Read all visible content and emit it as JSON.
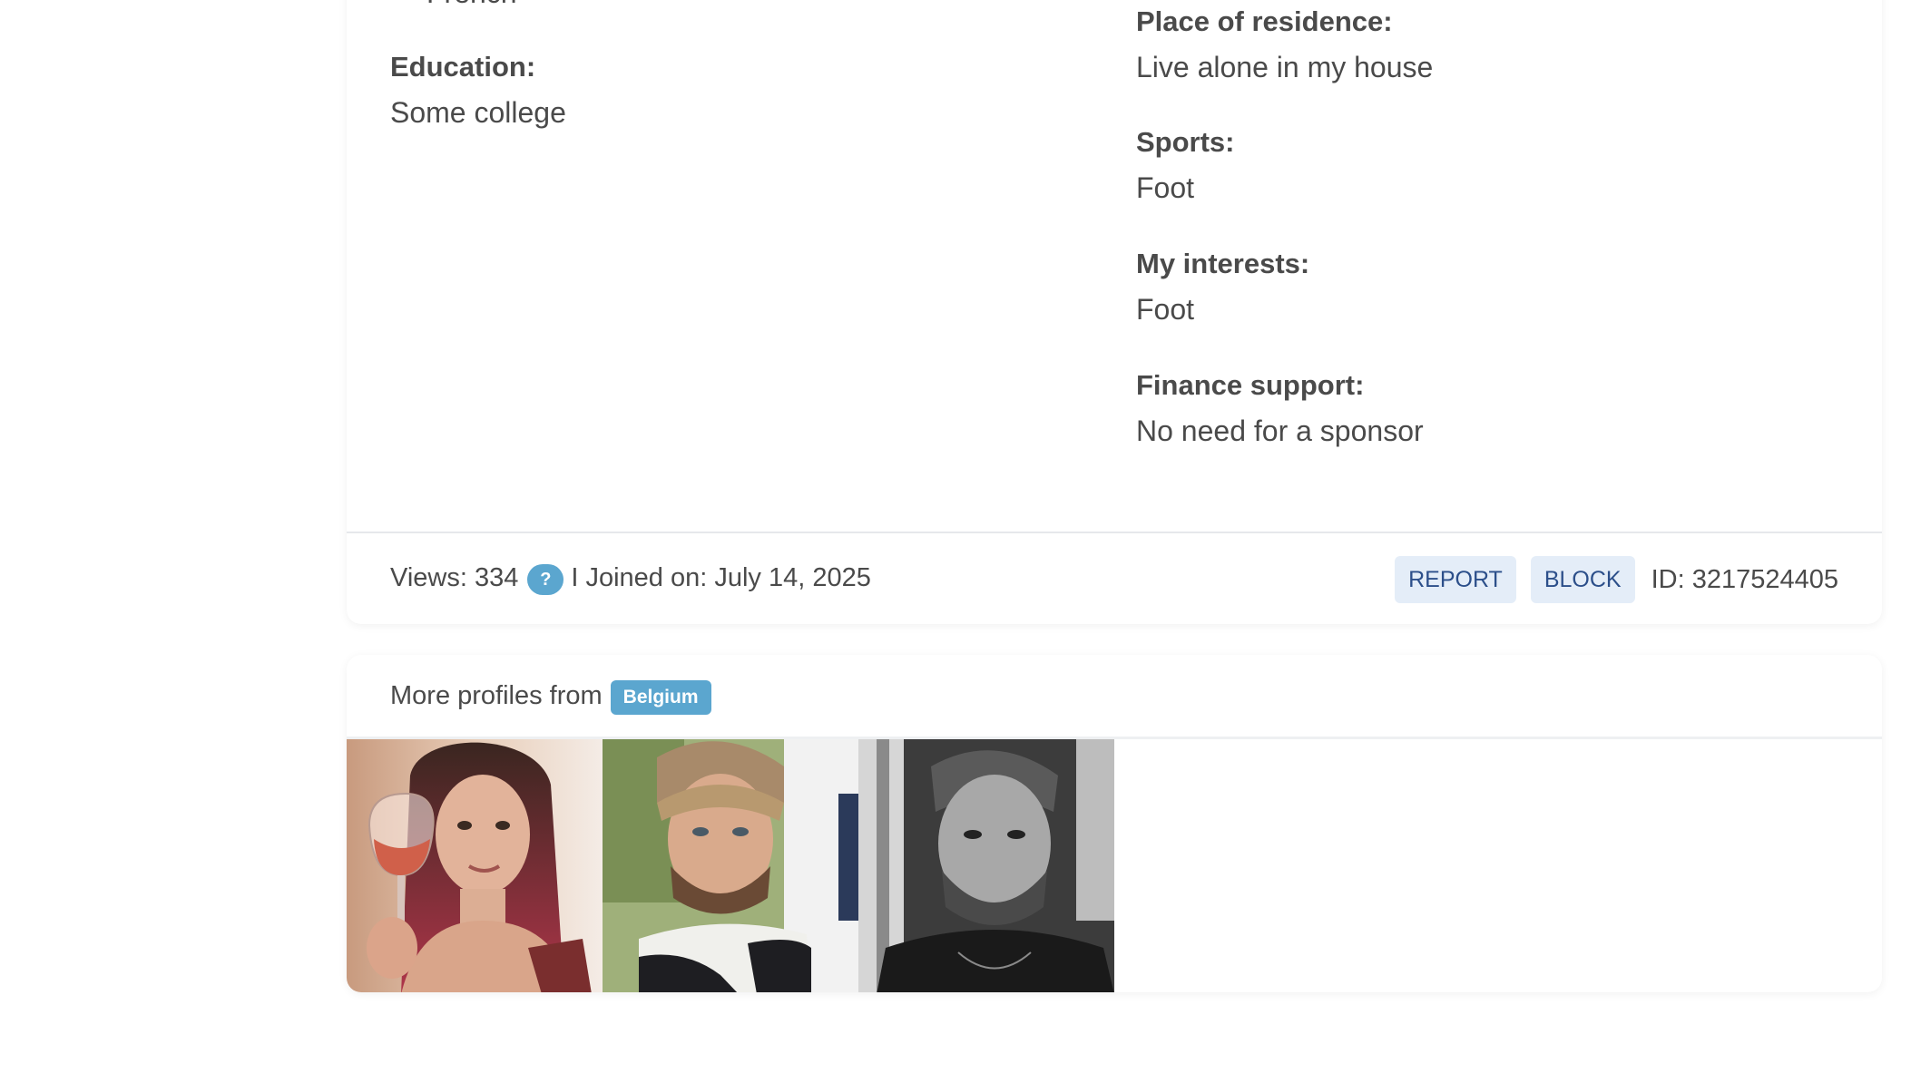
{
  "details": {
    "cut_off_language": "French",
    "left_fields": [
      {
        "label": "Education:",
        "value": "Some college"
      }
    ],
    "right_fields": [
      {
        "label": "Place of residence:",
        "value": "Live alone in my house"
      },
      {
        "label": "Sports:",
        "value": "Foot"
      },
      {
        "label": "My interests:",
        "value": "Foot"
      },
      {
        "label": "Finance support:",
        "value": "No need for a sponsor"
      }
    ]
  },
  "footer": {
    "views_label": "Views: 334",
    "help_icon": "?",
    "joined_label": "I Joined on: July 14, 2025",
    "report_button": "REPORT",
    "block_button": "BLOCK",
    "id_label": "ID: 3217524405"
  },
  "more_profiles": {
    "heading": "More profiles from",
    "country": "Belgium",
    "thumbnails": [
      {
        "icon": "woman-with-wine-glass-photo"
      },
      {
        "icon": "bearded-man-sweater-photo"
      },
      {
        "icon": "bearded-man-black-and-white-photo"
      }
    ]
  },
  "colors": {
    "accent_badge": "#5ba6cf",
    "button_bg": "#e4edf8",
    "button_text": "#2c4f8a",
    "text": "#4a4a4a"
  }
}
